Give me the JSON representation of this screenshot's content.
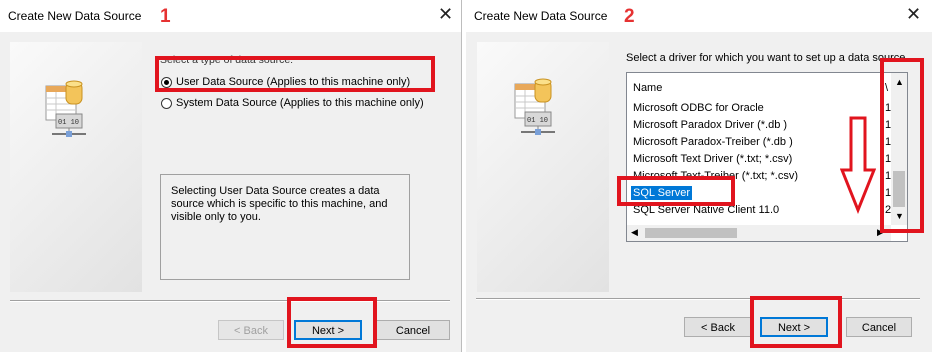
{
  "dialog1": {
    "title": "Create New Data Source",
    "step": "1",
    "prompt": "Select a type of data source:",
    "options": [
      {
        "label": "User Data Source (Applies to this machine only)",
        "selected": true
      },
      {
        "label": "System Data Source (Applies to this machine only)",
        "selected": false
      }
    ],
    "description": "Selecting User Data Source creates a data source which is specific to this machine, and visible only to you.",
    "buttons": {
      "back": "< Back",
      "next": "Next >",
      "cancel": "Cancel"
    }
  },
  "dialog2": {
    "title": "Create New Data Source",
    "step": "2",
    "prompt": "Select a driver for which you want to set up a data source.",
    "columns": {
      "name": "Name",
      "version": "\\"
    },
    "drivers": [
      {
        "name": "Microsoft ODBC for Oracle",
        "version": "1"
      },
      {
        "name": "Microsoft Paradox Driver (*.db )",
        "version": "1"
      },
      {
        "name": "Microsoft Paradox-Treiber (*.db )",
        "version": "1"
      },
      {
        "name": "Microsoft Text Driver (*.txt; *.csv)",
        "version": "1"
      },
      {
        "name": "Microsoft Text-Treiber (*.txt; *.csv)",
        "version": "1"
      },
      {
        "name": "SQL Server",
        "version": "1",
        "selected": true
      },
      {
        "name": "SQL Server Native Client 11.0",
        "version": "2"
      }
    ],
    "buttons": {
      "back": "< Back",
      "next": "Next >",
      "cancel": "Cancel"
    }
  },
  "colors": {
    "annotation_red": "#e1141e",
    "selection_blue": "#0078d7"
  },
  "icons": [
    "close-icon",
    "data-source-icon",
    "down-arrow-annotation-icon",
    "scroll-up-icon",
    "scroll-down-icon",
    "scroll-left-icon",
    "scroll-right-icon"
  ]
}
